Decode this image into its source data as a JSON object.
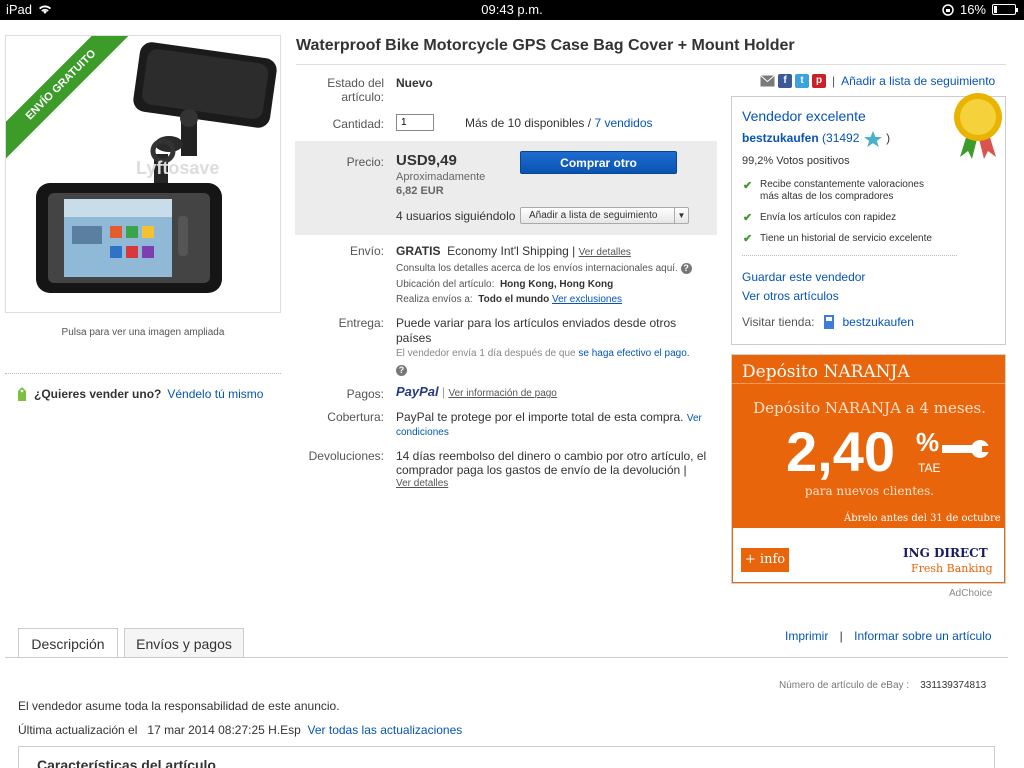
{
  "status_bar": {
    "device": "iPad",
    "time": "09:43 p.m.",
    "battery": "16%",
    "battery_level": 0.16
  },
  "left": {
    "ribbon": "ENVÍO GRATUITO",
    "watermark": "Lyftosave",
    "image_caption": "Pulsa para ver una imagen ampliada",
    "sell_question": "¿Quieres vender uno?",
    "sell_link": "Véndelo tú mismo"
  },
  "title": "Waterproof Bike Motorcycle GPS Case Bag Cover + Mount Holder",
  "item": {
    "condition_label_1": "Estado del",
    "condition_label_2": "artículo:",
    "condition_value": "Nuevo",
    "qty_label": "Cantidad:",
    "qty_value": "1",
    "availability": "Más de 10 disponibles",
    "sep": "/",
    "sold_link": "7 vendidos",
    "price_label": "Precio:",
    "price": "USD9,49",
    "approx": "Aproximadamente",
    "eur": "6,82 EUR",
    "buy_button": "Comprar otro",
    "watchers": "4 usuarios siguiéndolo",
    "watch_button": "Añadir a lista de seguimiento",
    "shipping_label": "Envío:",
    "shipping_free": "GRATIS",
    "shipping_service": "Economy Int'l Shipping |",
    "shipping_details": "Ver detalles",
    "intl_note": "Consulta los detalles acerca de los envíos internacionales aquí.",
    "location_label": "Ubicación del artículo:",
    "location": "Hong Kong, Hong Kong",
    "ships_to_label": "Realiza envíos a:",
    "ships_to": "Todo el mundo",
    "exclusions": "Ver exclusiones",
    "delivery_label": "Entrega:",
    "delivery_1": "Puede variar para los artículos enviados desde otros",
    "delivery_2": "países",
    "dispatch_text": "El vendedor envía 1 día después de que",
    "dispatch_link": "se haga efectivo el pago.",
    "payments_label": "Pagos:",
    "paypal": "PayPal",
    "payment_info": "Ver información de pago",
    "coverage_label": "Cobertura:",
    "coverage_text": "PayPal te protege por el importe total de esta compra.",
    "coverage_link_1": "Ver",
    "coverage_link_2": "condiciones",
    "returns_label": "Devoluciones:",
    "returns_1": "14 días reembolso del dinero o cambio por otro artículo, el",
    "returns_2": "comprador paga los gastos de envío de la devolución |",
    "returns_link": "Ver detalles"
  },
  "share": {
    "watchlist_link": "Añadir a lista de seguimiento",
    "sep": "|"
  },
  "seller": {
    "badge_title": "Vendedor excelente",
    "name": "bestzukaufen",
    "feedback_open": "(31492",
    "feedback_close": ")",
    "positive": "99,2% Votos positivos",
    "features": [
      "Recibe constantemente valoraciones",
      "más altas de los compradores",
      "Envía los artículos con rapidez",
      "Tiene un historial de servicio excelente"
    ],
    "save_seller": "Guardar este vendedor",
    "other_items": "Ver otros artículos",
    "store_label": "Visitar tienda:",
    "store_name": "bestzukaufen"
  },
  "ad": {
    "title": "Depósito NARANJA",
    "subtitle": "Depósito NARANJA a 4 meses.",
    "rate": "2,40",
    "percent": "%",
    "tae": "TAE",
    "for_new": "para nuevos clientes.",
    "open_before": "Ábrelo antes del 31 de octubre",
    "info_button": "+ info",
    "brand": "ING DIRECT",
    "brand_sub": "Fresh Banking",
    "adchoice": "AdChoice"
  },
  "tabs": {
    "description": "Descripción",
    "shipping_payments": "Envíos y pagos",
    "print": "Imprimir",
    "sep": "|",
    "report": "Informar sobre un artículo"
  },
  "footer": {
    "item_number_label": "Número de artículo de eBay :",
    "item_number": "331139374813",
    "responsibility": "El vendedor asume toda la responsabilidad de este anuncio.",
    "updated_label": "Última actualización el",
    "updated_value": "17 mar 2014 08:27:25 H.Esp",
    "all_updates": "Ver todas las actualizaciones",
    "characteristics": "Características del artículo"
  },
  "colors": {
    "link": "#0654ba",
    "ribbon": "#3d9b2a",
    "ad_orange": "#e8650b",
    "buy_button": "#0a53b0"
  }
}
